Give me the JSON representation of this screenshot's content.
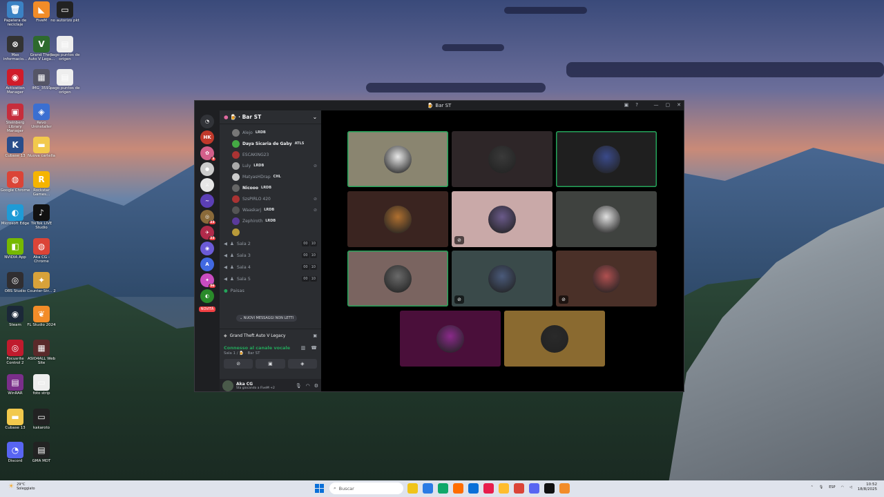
{
  "desktop": {
    "icons": [
      {
        "label": "Papelera de reciclaje",
        "glyph": "🗑",
        "color": "#3b82c4"
      },
      {
        "label": "FiveM",
        "glyph": "◣",
        "color": "#f28c28"
      },
      {
        "label": "no autorizo pkt",
        "glyph": "▭",
        "color": "#222"
      },
      {
        "label": "Mas informacio...",
        "glyph": "⊗",
        "color": "#333"
      },
      {
        "label": "Grand Theft Auto V Lega...",
        "glyph": "V",
        "color": "#2e6a2e"
      },
      {
        "label": "pago puntos de origen",
        "glyph": "▤",
        "color": "#eee"
      },
      {
        "label": "Activation Manager",
        "glyph": "◉",
        "color": "#d01c2a"
      },
      {
        "label": "IMG_3591",
        "glyph": "▦",
        "color": "#556"
      },
      {
        "label": "pago puntos de origen",
        "glyph": "▤",
        "color": "#eee"
      },
      {
        "label": "Steinberg Library Manager",
        "glyph": "▣",
        "color": "#c62d3c"
      },
      {
        "label": "Revo Uninstaller",
        "glyph": "◈",
        "color": "#3b6fd1"
      },
      {
        "label": "Cubase 13",
        "glyph": "K",
        "color": "#2a4d8a"
      },
      {
        "label": "Nuova cartella",
        "glyph": "▬",
        "color": "#f2c94c"
      },
      {
        "label": "Google Chrome",
        "glyph": "◍",
        "color": "#db4437"
      },
      {
        "label": "Rockstar Games...",
        "glyph": "R",
        "color": "#f5b400"
      },
      {
        "label": "Microsoft Edge",
        "glyph": "◐",
        "color": "#1f9bd6"
      },
      {
        "label": "TikTok LIVE Studio",
        "glyph": "♪",
        "color": "#111"
      },
      {
        "label": "NVIDIA App",
        "glyph": "◧",
        "color": "#76b900"
      },
      {
        "label": "Aka CG - Chrome",
        "glyph": "◍",
        "color": "#db4437"
      },
      {
        "label": "OBS Studio",
        "glyph": "◎",
        "color": "#302e31"
      },
      {
        "label": "Counter-Str... 2",
        "glyph": "✦",
        "color": "#d8a23a"
      },
      {
        "label": "Steam",
        "glyph": "◉",
        "color": "#1b2838"
      },
      {
        "label": "FL Studio 2024",
        "glyph": "❦",
        "color": "#f28c28"
      },
      {
        "label": "Focusrite Control 2",
        "glyph": "◎",
        "color": "#c01b2d"
      },
      {
        "label": "ASIO4ALL Web Site",
        "glyph": "▦",
        "color": "#5a2a2a"
      },
      {
        "label": "WinRAR",
        "glyph": "▤",
        "color": "#7a2e8a"
      },
      {
        "label": "foto strip",
        "glyph": "▭",
        "color": "#eee"
      },
      {
        "label": "Cubase 13",
        "glyph": "▬",
        "color": "#f2c94c"
      },
      {
        "label": "kakaroto",
        "glyph": "▭",
        "color": "#222"
      },
      {
        "label": "Discord",
        "glyph": "◔",
        "color": "#5865f2"
      },
      {
        "label": "GMA MDT",
        "glyph": "▤",
        "color": "#222"
      }
    ]
  },
  "window": {
    "title": "Bar ST",
    "title_emoji": "🍺"
  },
  "guilds": [
    {
      "label": "HK",
      "color": "#c0392b",
      "badge": ""
    },
    {
      "label": "✿",
      "color": "#d35f8a",
      "badge": "3"
    },
    {
      "label": "●",
      "color": "#ccc",
      "badge": ""
    },
    {
      "label": "⚔",
      "color": "#e6e6e6",
      "badge": ""
    },
    {
      "label": "~",
      "color": "#5b3fb5",
      "badge": ""
    },
    {
      "label": "◎",
      "color": "#8a6a3a",
      "badge": "23"
    },
    {
      "label": "✈",
      "color": "#b02a4a",
      "badge": "23"
    },
    {
      "label": "◉",
      "color": "#6b5bd6",
      "badge": ""
    },
    {
      "label": "A",
      "color": "#4169e1",
      "badge": ""
    },
    {
      "label": "✦",
      "color": "#c94cc0",
      "badge": "56"
    },
    {
      "label": "◐",
      "color": "#2a8a2a",
      "badge": ""
    }
  ],
  "guild_new_label": "NOVITÀ",
  "channel_panel": {
    "server_name": "Bar ST",
    "members": [
      {
        "name": "Alejo",
        "tag": "LRDB",
        "color": "#777",
        "muted": false,
        "bright": false
      },
      {
        "name": "Daya Sicaria de Gaby",
        "tag": "ATLS",
        "color": "#4a4",
        "muted": false,
        "bright": true
      },
      {
        "name": "ESCAKING23",
        "tag": "",
        "color": "#a33",
        "muted": false,
        "bright": false
      },
      {
        "name": "Luly",
        "tag": "LRDB",
        "color": "#aaa",
        "muted": true,
        "bright": false
      },
      {
        "name": "MatyasHDrap",
        "tag": "CHL",
        "color": "#ccc",
        "muted": false,
        "bright": false
      },
      {
        "name": "Nicooo",
        "tag": "LRDB",
        "color": "#666",
        "muted": false,
        "bright": true
      },
      {
        "name": "SzsPIRLO 420",
        "tag": "",
        "color": "#a33",
        "muted": true,
        "bright": false
      },
      {
        "name": "Waaskarj",
        "tag": "LRDB",
        "color": "#555",
        "muted": true,
        "bright": false
      },
      {
        "name": "Zephiroth",
        "tag": "LRDB",
        "color": "#5a3a9a",
        "muted": false,
        "bright": false
      },
      {
        "name": "",
        "tag": "",
        "color": "#b89a3a",
        "muted": false,
        "bright": false
      }
    ],
    "voice_channels": [
      {
        "name": "Sala 2",
        "count_a": "00",
        "count_b": "10"
      },
      {
        "name": "Sala 3",
        "count_a": "00",
        "count_b": "10"
      },
      {
        "name": "Sala 4",
        "count_a": "00",
        "count_b": "10"
      },
      {
        "name": "Sala 5",
        "count_a": "00",
        "count_b": "10"
      }
    ],
    "category_label": "Paisas",
    "unread_label": "NUOVI MESSAGGI NON LETTI",
    "game_activity": "Grand Theft Auto V Legacy",
    "voice_status": {
      "connected_label": "Connesso al canale vocale",
      "channel_path": "Sala 1 / 🍺 · Bar ST"
    },
    "user": {
      "name": "Aka CG",
      "status": "Sta giocando a FiveM +2"
    }
  },
  "stage_tiles": [
    {
      "bg": "#8a8570",
      "av": "#e8e8e8",
      "speaking": true,
      "muted": false
    },
    {
      "bg": "#2e2628",
      "av": "#3a3a3a",
      "speaking": false,
      "muted": false
    },
    {
      "bg": "#1f1f1f",
      "av": "#3a4a8a",
      "speaking": true,
      "muted": false
    },
    {
      "bg": "#3a2420",
      "av": "#b07030",
      "speaking": false,
      "muted": false
    },
    {
      "bg": "#c9a9a8",
      "av": "#6a5a8a",
      "speaking": false,
      "muted": true
    },
    {
      "bg": "#3f423f",
      "av": "#e0e0e0",
      "speaking": false,
      "muted": false
    },
    {
      "bg": "#7a6460",
      "av": "#6a6a6a",
      "speaking": true,
      "muted": false
    },
    {
      "bg": "#3a4a4a",
      "av": "#4a5a7a",
      "speaking": false,
      "muted": true
    },
    {
      "bg": "#4a3028",
      "av": "#b05050",
      "speaking": false,
      "muted": true
    },
    {
      "bg": "#4a0f3a",
      "av": "#8a2a8a",
      "speaking": false,
      "muted": false
    },
    {
      "bg": "#8a6a30",
      "av": "#2a2a2a",
      "speaking": false,
      "muted": false
    }
  ],
  "taskbar": {
    "weather_temp": "29°C",
    "weather_desc": "Soleggiato",
    "search_placeholder": "Buscar",
    "lang": "ESP",
    "time": "10:52",
    "date": "18/8/2025",
    "apps": [
      "#f0c419",
      "#2b7be4",
      "#0fa86a",
      "#ff6d00",
      "#0a6fd8",
      "#e81d4c",
      "#ffbd2e",
      "#db4437",
      "#5865f2",
      "#111",
      "#f28c28"
    ]
  }
}
